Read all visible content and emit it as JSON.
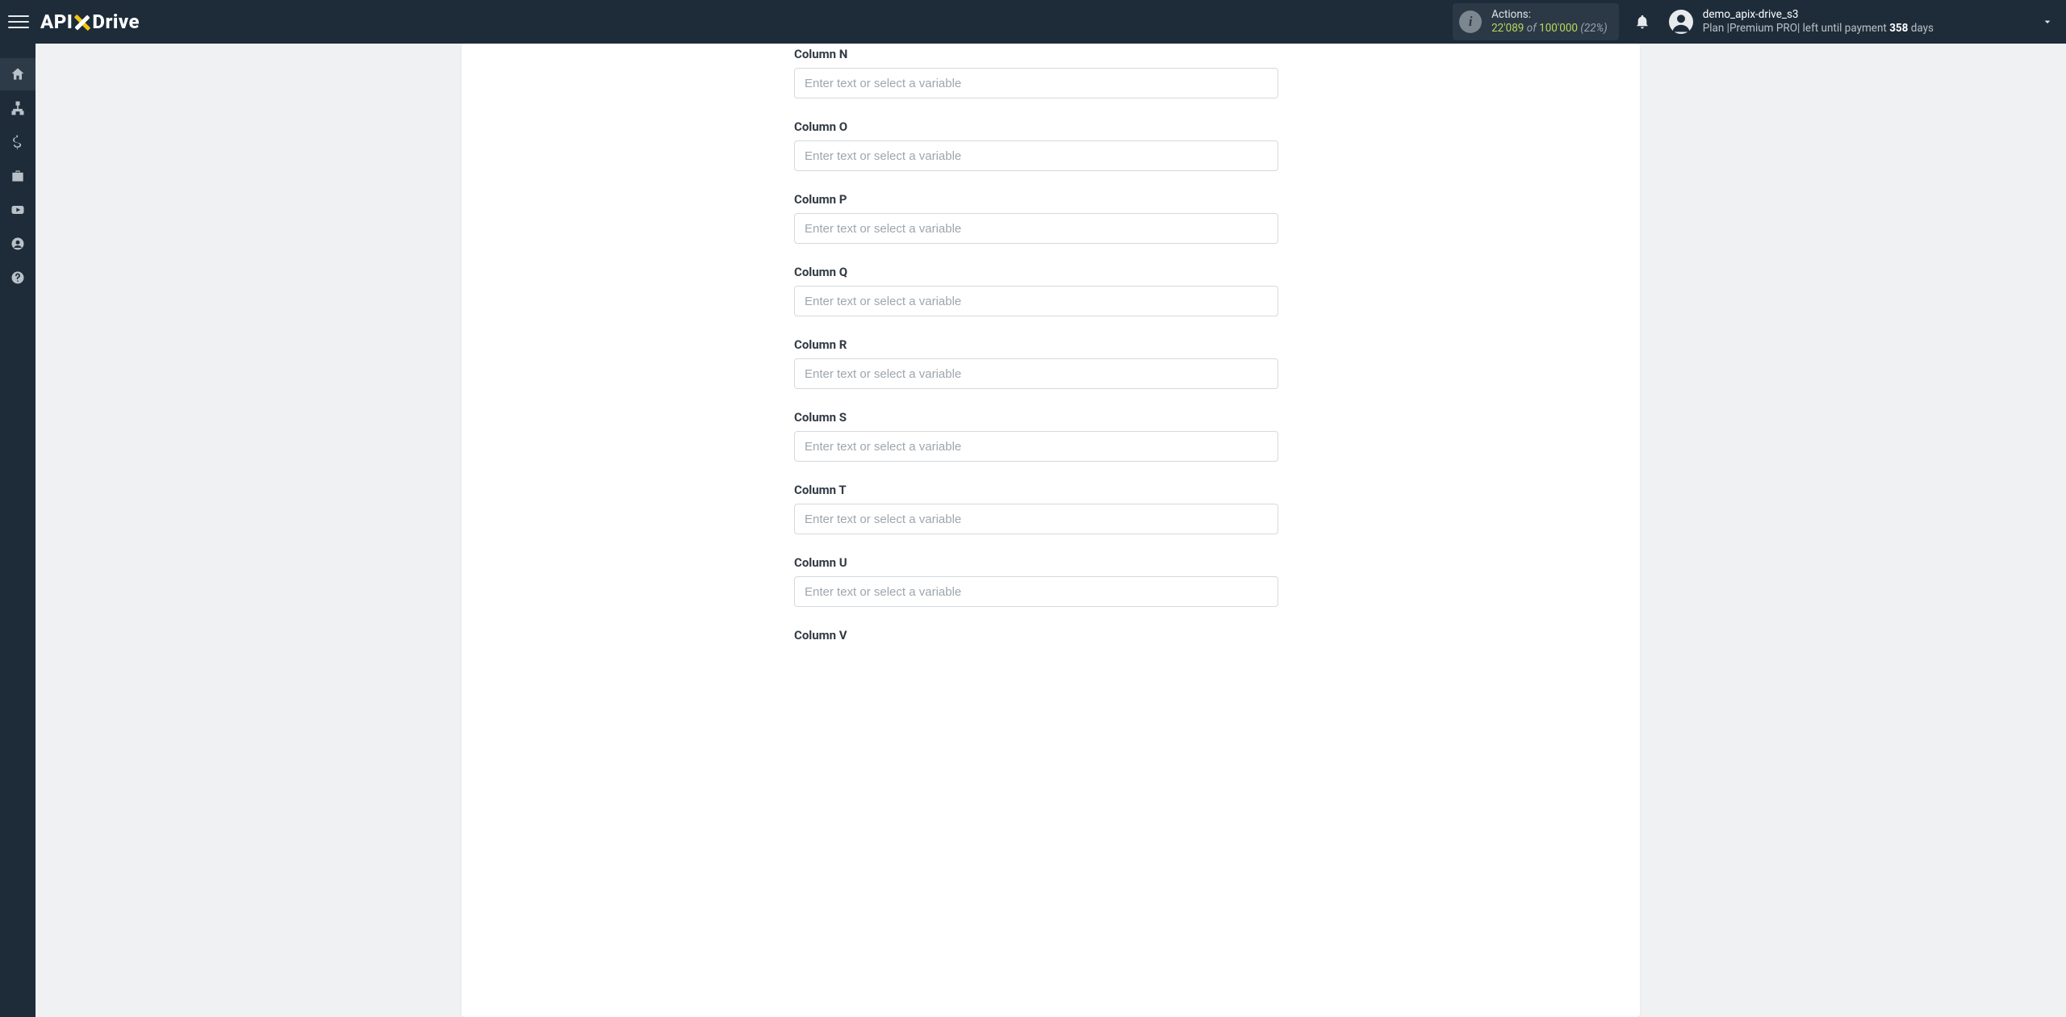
{
  "header": {
    "logo_left": "API",
    "logo_right": "Drive",
    "actions": {
      "label": "Actions:",
      "used": "22'089",
      "of": "of",
      "limit": "100'000",
      "pct": "(22%)"
    },
    "user": {
      "name": "demo_apix-drive_s3",
      "plan_prefix": "Plan |",
      "plan_name": "Premium PRO",
      "plan_mid": "| left until payment ",
      "days": "358",
      "plan_suffix": " days"
    }
  },
  "sidebar": {
    "items": [
      {
        "name": "home"
      },
      {
        "name": "connections"
      },
      {
        "name": "billing"
      },
      {
        "name": "briefcase"
      },
      {
        "name": "youtube"
      },
      {
        "name": "account"
      },
      {
        "name": "help"
      }
    ]
  },
  "form": {
    "placeholder": "Enter text or select a variable",
    "columns": [
      {
        "label": "Column N"
      },
      {
        "label": "Column O"
      },
      {
        "label": "Column P"
      },
      {
        "label": "Column Q"
      },
      {
        "label": "Column R"
      },
      {
        "label": "Column S"
      },
      {
        "label": "Column T"
      },
      {
        "label": "Column U"
      },
      {
        "label": "Column V"
      }
    ]
  }
}
